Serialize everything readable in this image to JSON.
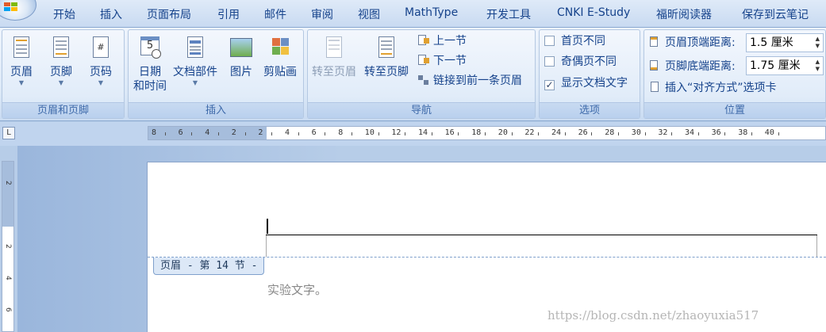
{
  "tabs": [
    "开始",
    "插入",
    "页面布局",
    "引用",
    "邮件",
    "审阅",
    "视图",
    "MathType",
    "开发工具",
    "CNKI E-Study",
    "福昕阅读器",
    "保存到云笔记"
  ],
  "groups": {
    "header_footer": {
      "label": "页眉和页脚",
      "header": "页眉",
      "footer": "页脚",
      "page_number": "页码"
    },
    "insert": {
      "label": "插入",
      "date_time_1": "日期",
      "date_time_2": "和时间",
      "doc_parts": "文档部件",
      "picture": "图片",
      "clipart": "剪贴画"
    },
    "navigation": {
      "label": "导航",
      "goto_header": "转至页眉",
      "goto_footer": "转至页脚",
      "prev_section": "上一节",
      "next_section": "下一节",
      "link_prev": "链接到前一条页眉"
    },
    "options": {
      "label": "选项",
      "first_page_diff": "首页不同",
      "odd_even_diff": "奇偶页不同",
      "show_doc_text": "显示文档文字",
      "show_doc_text_checked": "✓"
    },
    "position": {
      "label": "位置",
      "header_top_label": "页眉顶端距离:",
      "header_top_value": "1.5 厘米",
      "footer_bottom_label": "页脚底端距离:",
      "footer_bottom_value": "1.75 厘米",
      "insert_align_tab": "插入“对齐方式”选项卡"
    }
  },
  "ruler": {
    "corner": "L",
    "h_ticks": [
      "8",
      "6",
      "4",
      "2",
      "2",
      "4",
      "6",
      "8",
      "10",
      "12",
      "14",
      "16",
      "18",
      "20",
      "22",
      "24",
      "26",
      "28",
      "30",
      "32",
      "34",
      "36",
      "38",
      "40"
    ],
    "v_ticks": [
      "2",
      "2",
      "4",
      "6"
    ]
  },
  "document": {
    "header_tag": "页眉 - 第 14 节 -",
    "body_text": "实验文字。",
    "watermark": "https://blog.csdn.net/zhaoyuxia517"
  }
}
